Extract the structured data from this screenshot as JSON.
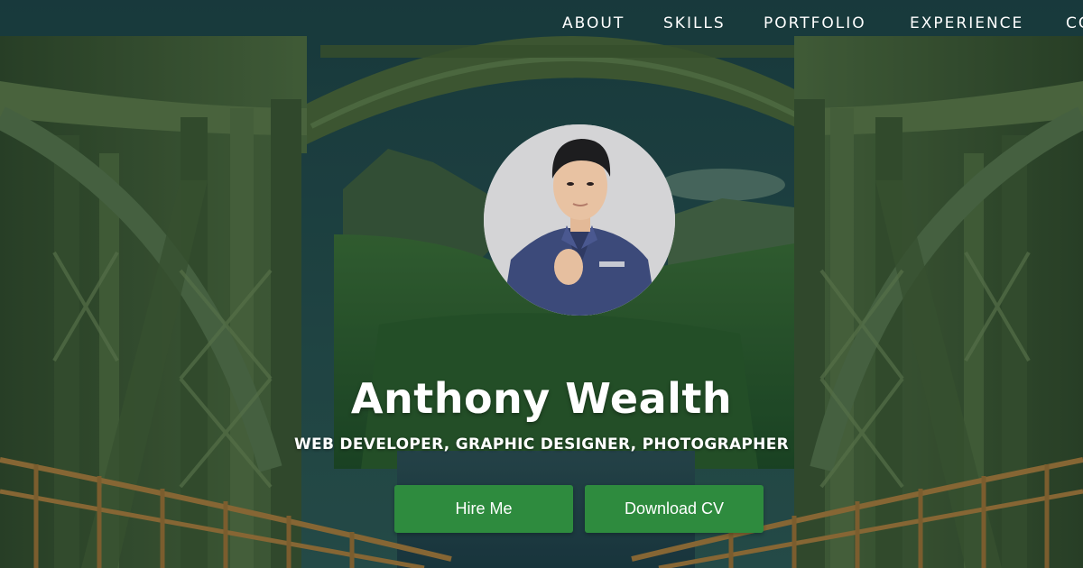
{
  "nav": {
    "items": [
      {
        "label": "ABOUT"
      },
      {
        "label": "SKILLS"
      },
      {
        "label": "PORTFOLIO"
      },
      {
        "label": "EXPERIENCE"
      },
      {
        "label": "CONTACT"
      }
    ]
  },
  "hero": {
    "name": "Anthony Wealth",
    "subtitle": "WEB DEVELOPER, GRAPHIC DESIGNER, PHOTOGRAPHER",
    "hire_button": "Hire Me",
    "cv_button": "Download CV"
  },
  "colors": {
    "accent_green": "#2e8b3e",
    "text": "#ffffff",
    "sky": "#1f4a4c",
    "bridge_steel": "#4a6339",
    "railing": "#a8793a"
  }
}
